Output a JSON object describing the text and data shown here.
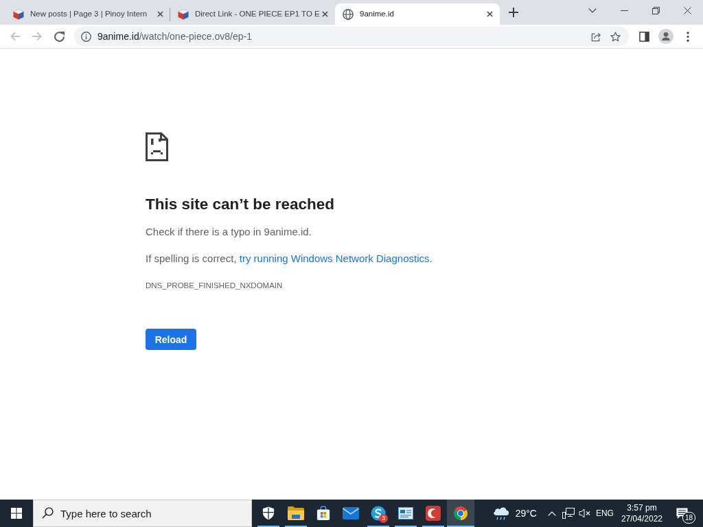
{
  "browser": {
    "tabs": [
      {
        "kind": "cube",
        "title": "New posts | Page 3 | Pinoy Intern",
        "selected": false
      },
      {
        "kind": "cube",
        "title": "Direct Link - ONE PIECE EP1 TO E",
        "selected": false
      },
      {
        "kind": "globe",
        "title": "9anime.id",
        "selected": true
      }
    ],
    "nav_buttons": [
      {
        "kind": "back",
        "disabled": true
      },
      {
        "kind": "forward",
        "disabled": true
      },
      {
        "kind": "reload",
        "disabled": false
      }
    ],
    "address": {
      "host": "9anime.id",
      "path": "/watch/one-piece.ov8/ep-1"
    }
  },
  "error_page": {
    "title": "This site can’t be reached",
    "message": "Check if there is a typo in 9anime.id.",
    "suggestion": {
      "text": "If spelling is correct,",
      "link": "try running Windows Network Diagnostics",
      "end": "."
    },
    "error_code": "DNS_PROBE_FINISHED_NXDOMAIN",
    "button": "Reload"
  },
  "taskbar": {
    "search": {
      "placeholder": "Type here to search"
    },
    "apps": [
      {
        "kind": "shield",
        "running": true,
        "selected": false
      },
      {
        "kind": "folder",
        "running": true,
        "selected": false
      },
      {
        "kind": "store",
        "running": false,
        "selected": false
      },
      {
        "kind": "mail",
        "running": false,
        "selected": false
      },
      {
        "kind": "chat",
        "running": true,
        "selected": false,
        "badge": "3"
      },
      {
        "kind": "window",
        "running": true,
        "selected": false
      },
      {
        "kind": "crescent",
        "running": true,
        "selected": false
      },
      {
        "kind": "browser",
        "running": true,
        "selected": true
      }
    ],
    "temperature": "29°C",
    "language": "ENG",
    "time": "3:57 pm",
    "date": "27/04/2022",
    "notifications": "18"
  }
}
